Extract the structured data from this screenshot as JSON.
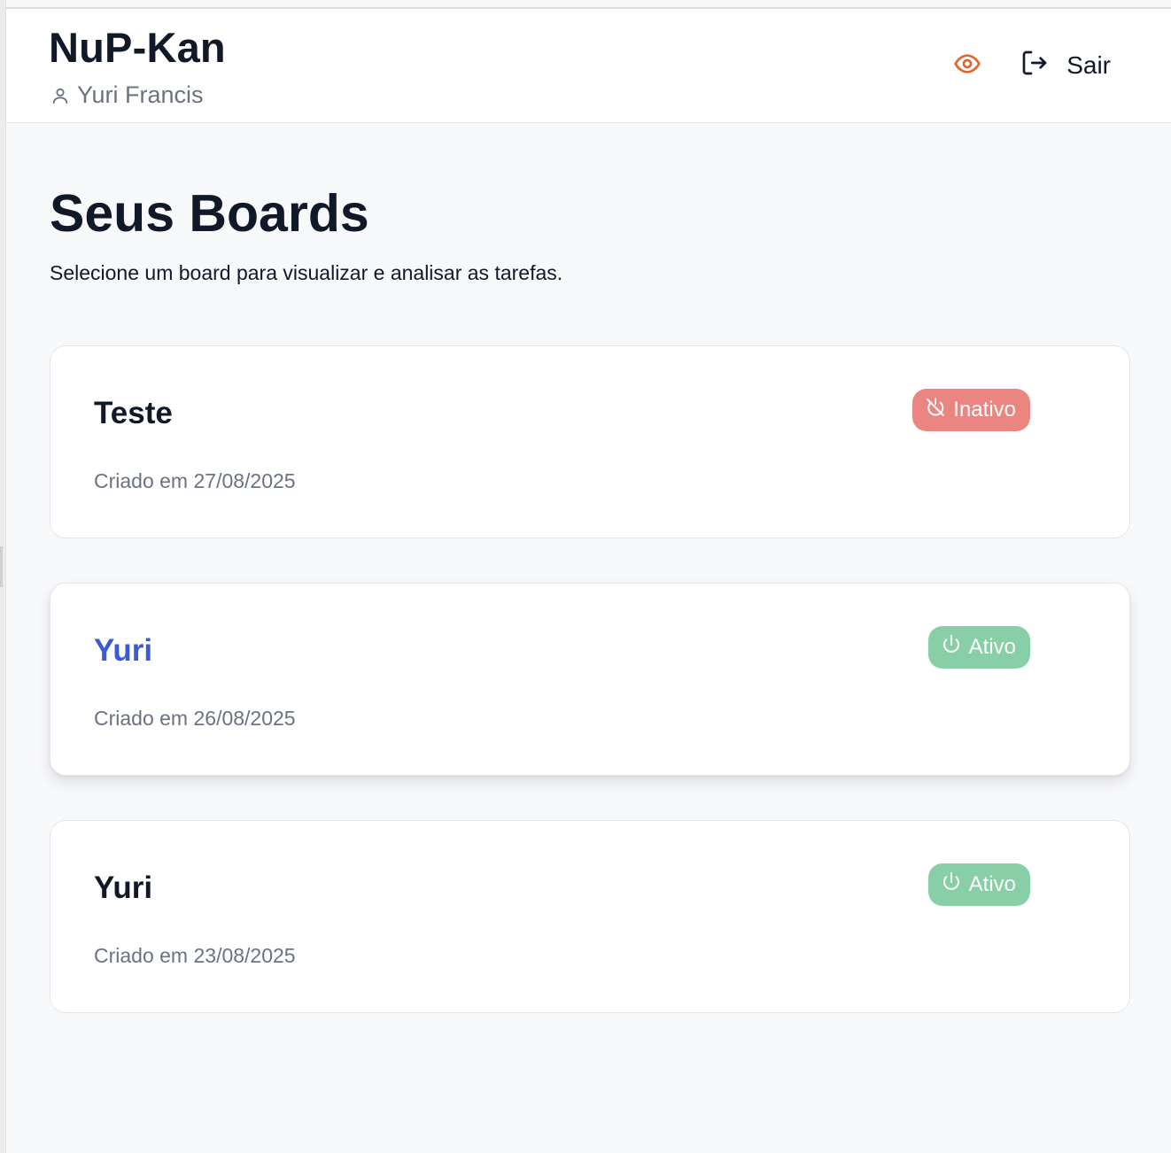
{
  "header": {
    "app_title": "NuP-Kan",
    "user_name": "Yuri Francis",
    "user_icon": "user-icon",
    "view_icon": "eye-icon",
    "logout_icon": "logout-icon",
    "logout_label": "Sair",
    "accent_color": "#e0662d"
  },
  "main": {
    "title": "Seus Boards",
    "subtitle": "Selecione um board para visualizar e analisar as tarefas."
  },
  "boards": [
    {
      "name": "Teste",
      "created": "Criado em 27/08/2025",
      "status": "Inativo",
      "status_icon": "power-off-icon",
      "status_color": "#ea8582"
    },
    {
      "name": "Yuri",
      "created": "Criado em 26/08/2025",
      "status": "Ativo",
      "status_icon": "power-icon",
      "status_color": "#88cfa7",
      "hovered": true,
      "hover_title_color": "#3b5bd6"
    },
    {
      "name": "Yuri",
      "created": "Criado em 23/08/2025",
      "status": "Ativo",
      "status_icon": "power-icon",
      "status_color": "#88cfa7"
    }
  ]
}
